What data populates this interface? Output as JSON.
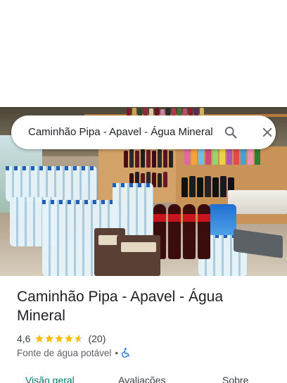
{
  "search": {
    "query": "Caminhão Pipa - Apavel - Água Mineral"
  },
  "place": {
    "name": "Caminhão Pipa - Apavel - Água Mineral",
    "rating": "4,6",
    "rating_value": 4.6,
    "reviews": "(20)",
    "category": "Fonte de água potável",
    "separator": "•"
  },
  "tabs": [
    {
      "label": "Visão geral",
      "active": true
    },
    {
      "label": "Avaliações",
      "active": false
    },
    {
      "label": "Sobre",
      "active": false
    }
  ],
  "icons": {
    "search": "search-icon",
    "close": "close-icon",
    "star": "star-icon",
    "accessibility": "wheelchair-icon"
  },
  "colors": {
    "star": "#fbbc04",
    "active_tab": "#00796b",
    "accessibility": "#1a73e8"
  }
}
